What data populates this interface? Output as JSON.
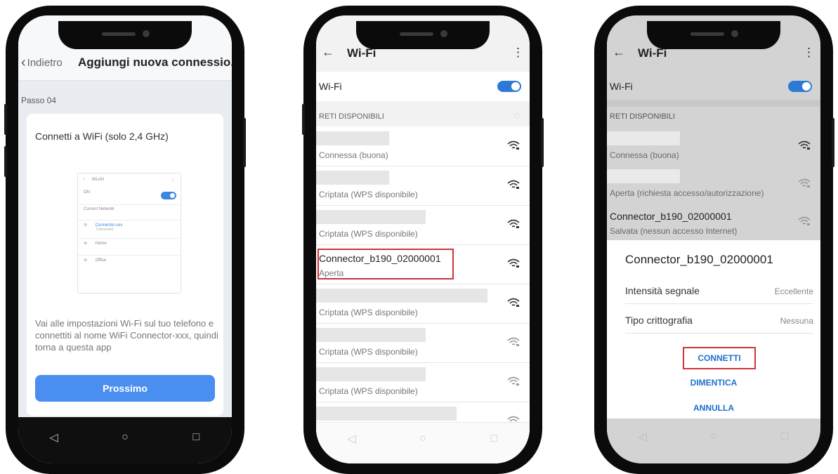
{
  "phone1": {
    "back_label": "Indietro",
    "title": "Aggiungi nuova connessio...",
    "step": "Passo 04",
    "card_heading": "Connetti a WiFi (solo 2,4 GHz)",
    "mini": {
      "title": "WLAN",
      "on": "ON",
      "current": "Current Network",
      "net1": "Connector-xxx",
      "net1_sub": "Connected",
      "net2": "Home",
      "net3": "Office"
    },
    "instructions": "Vai alle impostazioni Wi-Fi sul tuo telefono e connettiti al nome WiFi Connector-xxx, quindi torna a questa app",
    "next_button": "Prossimo"
  },
  "phone2": {
    "title": "Wi-Fi",
    "wifi_label": "Wi-Fi",
    "section": "RETI DISPONIBILI",
    "networks": [
      {
        "name": "",
        "status": "Connessa (buona)"
      },
      {
        "name": "",
        "status": "Criptata (WPS disponibile)"
      },
      {
        "name": "",
        "status": "Criptata (WPS disponibile)"
      },
      {
        "name": "Connector_b190_02000001",
        "status": "Aperta"
      },
      {
        "name": "",
        "status": "Criptata (WPS disponibile)"
      },
      {
        "name": "",
        "status": "Criptata (WPS disponibile)"
      },
      {
        "name": "",
        "status": "Criptata (WPS disponibile)"
      },
      {
        "name": "",
        "status": "Criptata (WPS disponibile)"
      }
    ]
  },
  "phone3": {
    "title": "Wi-Fi",
    "wifi_label": "Wi-Fi",
    "section": "RETI DISPONIBILI",
    "networks": [
      {
        "name": "",
        "status": "Connessa (buona)"
      },
      {
        "name": "",
        "status": "Aperta (richiesta accesso/autorizzazione)"
      },
      {
        "name": "Connector_b190_02000001",
        "status": "Salvata (nessun accesso Internet)"
      }
    ],
    "dialog": {
      "title": "Connector_b190_02000001",
      "signal_label": "Intensità segnale",
      "signal_value": "Eccellente",
      "enc_label": "Tipo crittografia",
      "enc_value": "Nessuna",
      "connect": "CONNETTI",
      "forget": "DIMENTICA",
      "cancel": "ANNULLA"
    }
  },
  "colors": {
    "accent": "#2d7ad6",
    "button_blue": "#4a8ff0",
    "highlight": "#d0333a",
    "dialog_link": "#1f6fcf"
  },
  "nav_icons": [
    "back-triangle-icon",
    "home-circle-icon",
    "recents-square-icon"
  ]
}
